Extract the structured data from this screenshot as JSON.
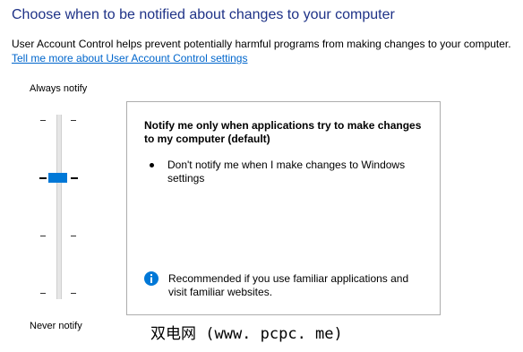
{
  "header": {
    "title": "Choose when to be notified about changes to your computer",
    "description": "User Account Control helps prevent potentially harmful programs from making changes to your computer.",
    "help_link": "Tell me more about User Account Control settings"
  },
  "slider": {
    "top_label": "Always notify",
    "bottom_label": "Never notify",
    "levels": 4,
    "selected_level": 3
  },
  "info_panel": {
    "heading": "Notify me only when applications try to make changes to my computer (default)",
    "bullet": "Don't notify me when I make changes to Windows settings",
    "recommendation": "Recommended if you use familiar applications and visit familiar websites."
  },
  "watermark": {
    "text": "双电网 (www. pcpc. me)"
  },
  "colors": {
    "title": "#1e3287",
    "link": "#0066cc",
    "accent": "#0078d7"
  },
  "icons": {
    "info": "info-icon",
    "bullet": "bullet-icon"
  }
}
